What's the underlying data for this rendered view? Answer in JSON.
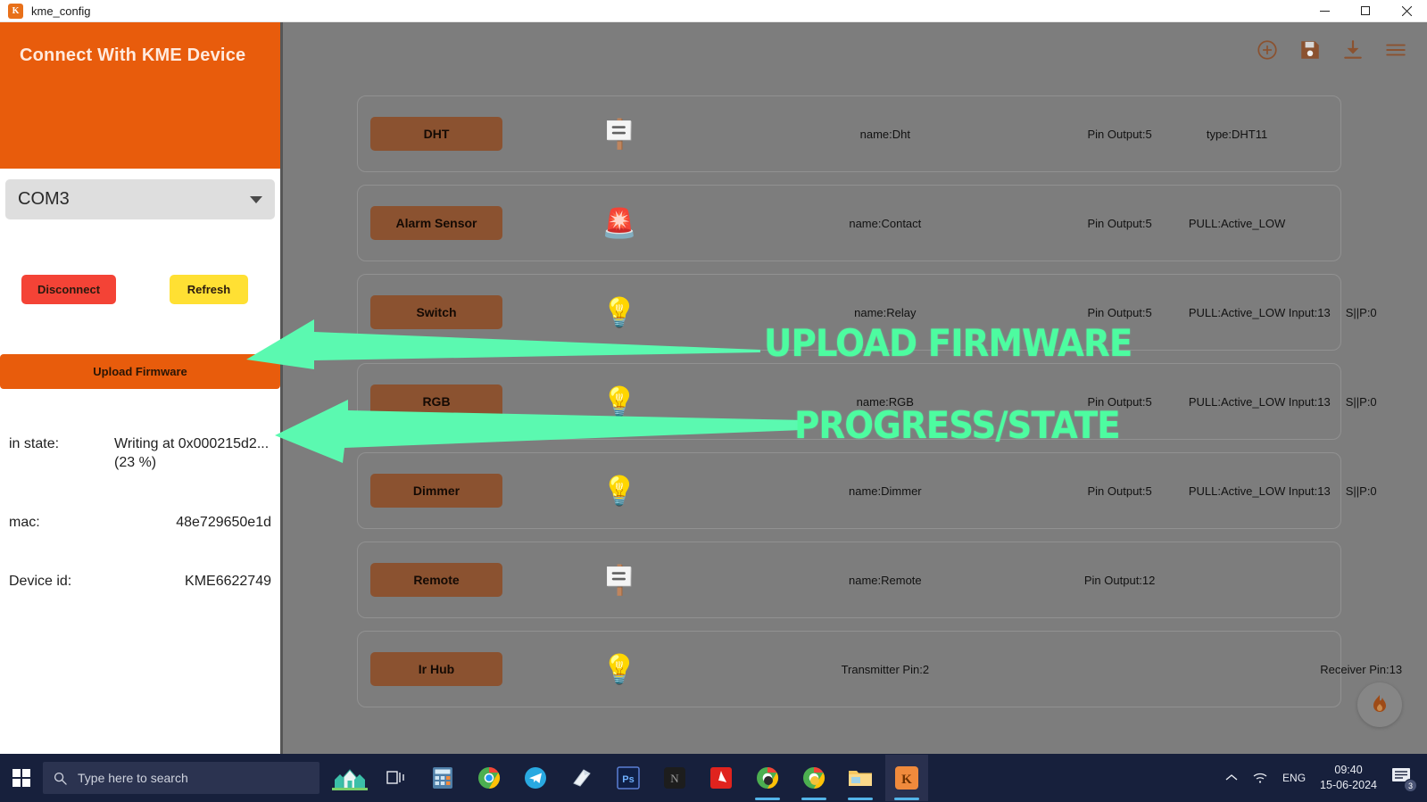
{
  "window": {
    "title": "kme_config",
    "icon_label": "K",
    "minimize": "minimize-icon",
    "maximize": "maximize-icon",
    "close": "close-icon"
  },
  "toolbar": {
    "icons": [
      {
        "name": "add-circle-icon",
        "label": "Add"
      },
      {
        "name": "save-icon",
        "label": "Save"
      },
      {
        "name": "download-icon",
        "label": "Download"
      },
      {
        "name": "menu-icon",
        "label": "Menu"
      }
    ],
    "accent_color": "#8b5230"
  },
  "sidebar": {
    "header_title": "Connect With KME Device",
    "header_color": "#e85c0c",
    "port_select": {
      "value": "COM3",
      "caret": "chevron-down-icon"
    },
    "buttons": {
      "disconnect": "Disconnect",
      "refresh": "Refresh",
      "upload": "Upload Firmware",
      "disconnect_color": "#f44336",
      "refresh_color": "#ffe033",
      "upload_color": "#e85c0c"
    },
    "info": [
      {
        "label": "in state:",
        "value": "Writing at 0x000215d2... (23 %)"
      },
      {
        "label": "mac:",
        "value": "48e729650e1d"
      },
      {
        "label": "Device id:",
        "value": "KME6622749"
      }
    ]
  },
  "devices": [
    {
      "button": "DHT",
      "icon": "blinds-icon",
      "glyph": "🪧",
      "name": "name:Dht",
      "pin": "Pin Output:5",
      "pull": "type:DHT11",
      "input": "",
      "sp": ""
    },
    {
      "button": "Alarm Sensor",
      "icon": "smoke-detector-icon",
      "glyph": "🚨",
      "name": "name:Contact",
      "pin": "Pin Output:5",
      "pull": "PULL:Active_LOW",
      "input": "",
      "sp": ""
    },
    {
      "button": "Switch",
      "icon": "lamp-icon",
      "glyph": "💡",
      "name": "name:Relay",
      "pin": "Pin Output:5",
      "pull": "PULL:Active_LOW",
      "input": "Input:13",
      "sp": "S||P:0"
    },
    {
      "button": "RGB",
      "icon": "lightbulb-icon",
      "glyph": "💡",
      "name": "name:RGB",
      "pin": "Pin Output:5",
      "pull": "PULL:Active_LOW",
      "input": "Input:13",
      "sp": "S||P:0"
    },
    {
      "button": "Dimmer",
      "icon": "lamp-icon",
      "glyph": "💡",
      "name": "name:Dimmer",
      "pin": "Pin Output:5",
      "pull": "PULL:Active_LOW",
      "input": "Input:13",
      "sp": "S||P:0"
    },
    {
      "button": "Remote",
      "icon": "blinds-icon",
      "glyph": "🪧",
      "name": "name:Remote",
      "pin": "Pin Output:12",
      "pull": "",
      "input": "",
      "sp": ""
    },
    {
      "button": "Ir Hub",
      "icon": "lamp-icon",
      "glyph": "💡",
      "name": "Transmitter Pin:2",
      "pin": "",
      "pull": "",
      "input": "",
      "sp": "Receiver Pin:13"
    }
  ],
  "fab": {
    "icon": "flame-icon"
  },
  "annotations": {
    "color": "#4dfca0",
    "items": [
      {
        "text": "UPLOAD FIRMWARE"
      },
      {
        "text": "PROGRESS/STATE"
      }
    ]
  },
  "taskbar": {
    "start": "windows-start-icon",
    "search_placeholder": "Type here to search",
    "search_icon": "search-icon",
    "apps": [
      {
        "name": "taskview-houses-icon",
        "label": ""
      },
      {
        "name": "task-view-icon",
        "label": ""
      },
      {
        "name": "calculator-icon",
        "label": ""
      },
      {
        "name": "chrome-icon",
        "label": ""
      },
      {
        "name": "telegram-icon",
        "label": ""
      },
      {
        "name": "sticky-notes-icon",
        "label": ""
      },
      {
        "name": "photoshop-icon",
        "label": "Ps"
      },
      {
        "name": "notion-icon",
        "label": "N"
      },
      {
        "name": "acrobat-reader-icon",
        "label": ""
      },
      {
        "name": "chrome-window-icon",
        "label": ""
      },
      {
        "name": "chrome-window2-icon",
        "label": ""
      },
      {
        "name": "file-explorer-icon",
        "label": ""
      },
      {
        "name": "kme-config-icon",
        "label": "K"
      }
    ],
    "tray": {
      "chevron": "show-hidden-icons",
      "network": "wifi-icon",
      "language": "ENG",
      "time": "09:40",
      "date": "15-06-2024",
      "notification_count": "3"
    }
  }
}
